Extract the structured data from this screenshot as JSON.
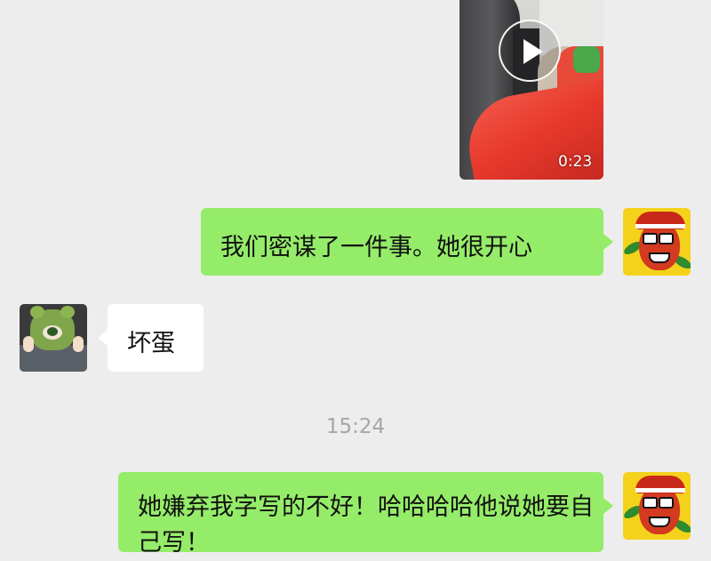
{
  "video": {
    "duration": "0:23",
    "play_icon": "play-icon"
  },
  "messages": [
    {
      "side": "right",
      "text": "我们密谋了一件事。她很开心"
    },
    {
      "side": "left",
      "text": "坏蛋"
    },
    {
      "side": "right",
      "text": "她嫌弃我字写的不好！哈哈哈哈他说她要自己写！"
    }
  ],
  "timestamp": "15:24",
  "colors": {
    "background": "#ededed",
    "sent_bubble": "#95ec69",
    "received_bubble": "#ffffff",
    "timestamp_text": "#a6a6a6"
  }
}
